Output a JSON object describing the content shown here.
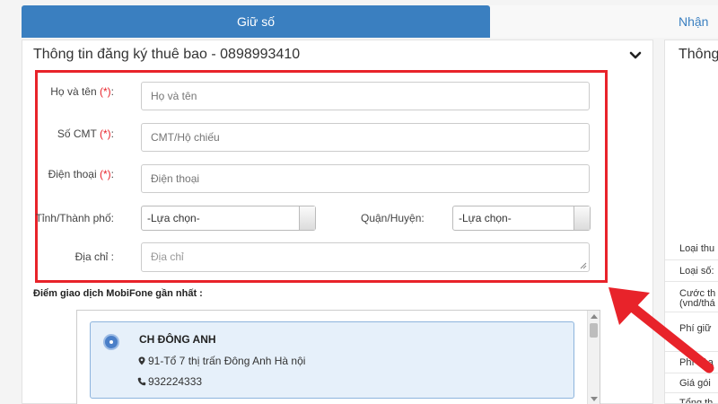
{
  "tabs": {
    "active": "Giữ số",
    "inactive": "Nhận"
  },
  "panel": {
    "title": "Thông tin đăng ký thuê bao - 0898993410"
  },
  "form": {
    "required_mark": "(*)",
    "fullname": {
      "label": "Họ và tên",
      "placeholder": "Họ và tên"
    },
    "id_card": {
      "label": "Số CMT",
      "placeholder": "CMT/Hộ chiếu"
    },
    "phone": {
      "label": "Điện thoại",
      "placeholder": "Điện thoại"
    },
    "province": {
      "label": "Tỉnh/Thành phố:",
      "value": "-Lựa chọn-"
    },
    "district": {
      "label": "Quận/Huyện:",
      "value": "-Lựa chọn-"
    },
    "address": {
      "label": "Địa chỉ :",
      "placeholder": "Địa chỉ"
    },
    "colon": ":"
  },
  "nearest": {
    "label": "Điểm giao dịch MobiFone gần nhất :",
    "stores": [
      {
        "name": "CH ĐÔNG ANH",
        "address": "91-Tổ 7 thị trấn Đông Anh Hà nội",
        "phone": "932224333"
      }
    ]
  },
  "right_panel": {
    "title": "Thông",
    "rows": [
      "Loại thu",
      "Loại số:",
      "Cước th",
      "(vnd/thá",
      "Phí giữ",
      "Phí hòa",
      "Giá gói",
      "Tổng th"
    ]
  },
  "colors": {
    "accent": "#3a7fc0",
    "highlight": "#e8232a",
    "selected_bg": "#e6f0fa"
  }
}
